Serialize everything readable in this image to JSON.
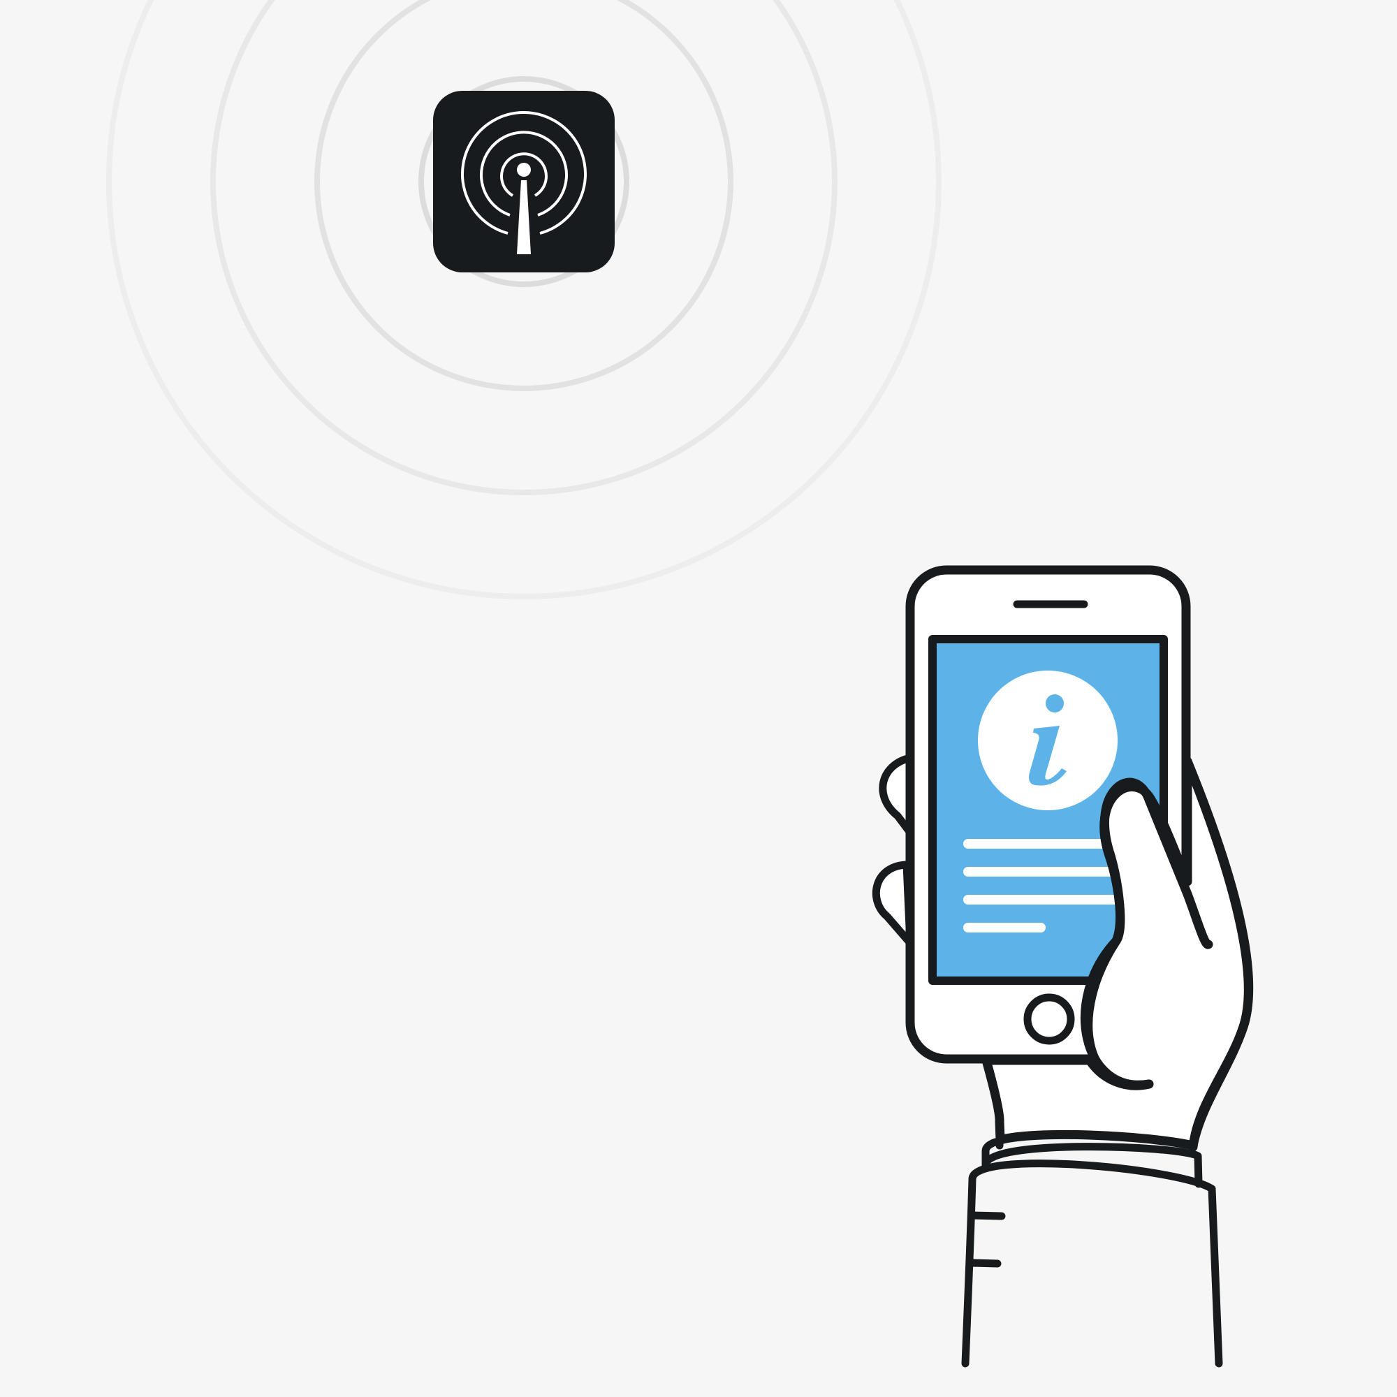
{
  "illustration": {
    "subject": "beacon-to-phone-proximity-notification",
    "icons": {
      "beacon": "broadcast-tower-icon",
      "phone_screen": "info-icon"
    }
  },
  "colors": {
    "background": "#f6f6f6",
    "ink": "#181b1e",
    "screen_blue": "#5db3e7",
    "white": "#ffffff",
    "ring_1": "#dcdcdc",
    "ring_2": "#e2e2e2",
    "ring_3": "#e8e8e8",
    "ring_4": "#ededed"
  },
  "phone": {
    "screen_content_lines": 4
  }
}
